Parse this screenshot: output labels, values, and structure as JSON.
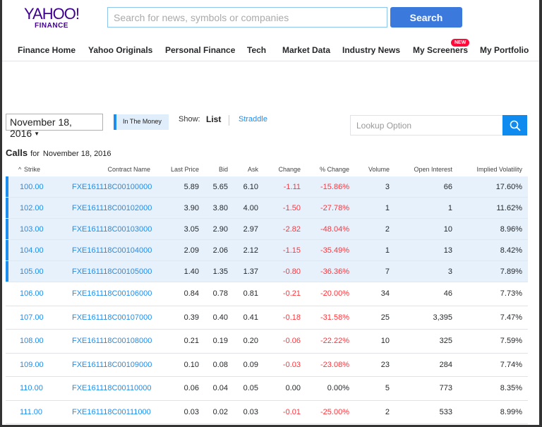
{
  "header": {
    "logo_top": "YAHOO!",
    "logo_bottom": "FINANCE",
    "search_placeholder": "Search for news, symbols or companies",
    "search_button": "Search"
  },
  "nav": {
    "items": [
      {
        "label": "Finance Home"
      },
      {
        "label": "Yahoo Originals"
      },
      {
        "label": "Personal Finance"
      },
      {
        "label": "Tech"
      },
      {
        "label": "Market Data"
      },
      {
        "label": "Industry News"
      },
      {
        "label": "My Screeners",
        "badge": "NEW"
      },
      {
        "label": "My Portfolio"
      }
    ]
  },
  "controls": {
    "expiration_date": "November 18, 2016",
    "in_the_money_label": "In The Money",
    "show_label": "Show:",
    "show_list": "List",
    "show_straddle": "Straddle",
    "lookup_placeholder": "Lookup Option"
  },
  "calls": {
    "title": "Calls",
    "for_label": "for",
    "date": "November 18, 2016",
    "columns": [
      "Strike",
      "Contract Name",
      "Last Price",
      "Bid",
      "Ask",
      "Change",
      "% Change",
      "Volume",
      "Open Interest",
      "Implied Volatility"
    ],
    "sort_indicator": "^",
    "rows": [
      {
        "strike": "100.00",
        "contract": "FXE161118C00100000",
        "last": "5.89",
        "bid": "5.65",
        "ask": "6.10",
        "change": "-1.11",
        "pct": "-15.86%",
        "volume": "3",
        "oi": "66",
        "iv": "17.60%",
        "itm": true
      },
      {
        "strike": "102.00",
        "contract": "FXE161118C00102000",
        "last": "3.90",
        "bid": "3.80",
        "ask": "4.00",
        "change": "-1.50",
        "pct": "-27.78%",
        "volume": "1",
        "oi": "1",
        "iv": "11.62%",
        "itm": true
      },
      {
        "strike": "103.00",
        "contract": "FXE161118C00103000",
        "last": "3.05",
        "bid": "2.90",
        "ask": "2.97",
        "change": "-2.82",
        "pct": "-48.04%",
        "volume": "2",
        "oi": "10",
        "iv": "8.96%",
        "itm": true
      },
      {
        "strike": "104.00",
        "contract": "FXE161118C00104000",
        "last": "2.09",
        "bid": "2.06",
        "ask": "2.12",
        "change": "-1.15",
        "pct": "-35.49%",
        "volume": "1",
        "oi": "13",
        "iv": "8.42%",
        "itm": true
      },
      {
        "strike": "105.00",
        "contract": "FXE161118C00105000",
        "last": "1.40",
        "bid": "1.35",
        "ask": "1.37",
        "change": "-0.80",
        "pct": "-36.36%",
        "volume": "7",
        "oi": "3",
        "iv": "7.89%",
        "itm": true
      },
      {
        "strike": "106.00",
        "contract": "FXE161118C00106000",
        "last": "0.84",
        "bid": "0.78",
        "ask": "0.81",
        "change": "-0.21",
        "pct": "-20.00%",
        "volume": "34",
        "oi": "46",
        "iv": "7.73%",
        "itm": false
      },
      {
        "strike": "107.00",
        "contract": "FXE161118C00107000",
        "last": "0.39",
        "bid": "0.40",
        "ask": "0.41",
        "change": "-0.18",
        "pct": "-31.58%",
        "volume": "25",
        "oi": "3,395",
        "iv": "7.47%",
        "itm": false
      },
      {
        "strike": "108.00",
        "contract": "FXE161118C00108000",
        "last": "0.21",
        "bid": "0.19",
        "ask": "0.20",
        "change": "-0.06",
        "pct": "-22.22%",
        "volume": "10",
        "oi": "325",
        "iv": "7.59%",
        "itm": false
      },
      {
        "strike": "109.00",
        "contract": "FXE161118C00109000",
        "last": "0.10",
        "bid": "0.08",
        "ask": "0.09",
        "change": "-0.03",
        "pct": "-23.08%",
        "volume": "23",
        "oi": "284",
        "iv": "7.74%",
        "itm": false
      },
      {
        "strike": "110.00",
        "contract": "FXE161118C00110000",
        "last": "0.06",
        "bid": "0.04",
        "ask": "0.05",
        "change": "0.00",
        "pct": "0.00%",
        "volume": "5",
        "oi": "773",
        "iv": "8.35%",
        "itm": false
      },
      {
        "strike": "111.00",
        "contract": "FXE161118C00111000",
        "last": "0.03",
        "bid": "0.02",
        "ask": "0.03",
        "change": "-0.01",
        "pct": "-25.00%",
        "volume": "2",
        "oi": "533",
        "iv": "8.99%",
        "itm": false
      }
    ]
  },
  "colors": {
    "brand_purple": "#400090",
    "link_blue": "#1d8eef",
    "negative_red": "#ff333a",
    "itm_background": "#e6f1fc",
    "search_button": "#3b79dd"
  }
}
